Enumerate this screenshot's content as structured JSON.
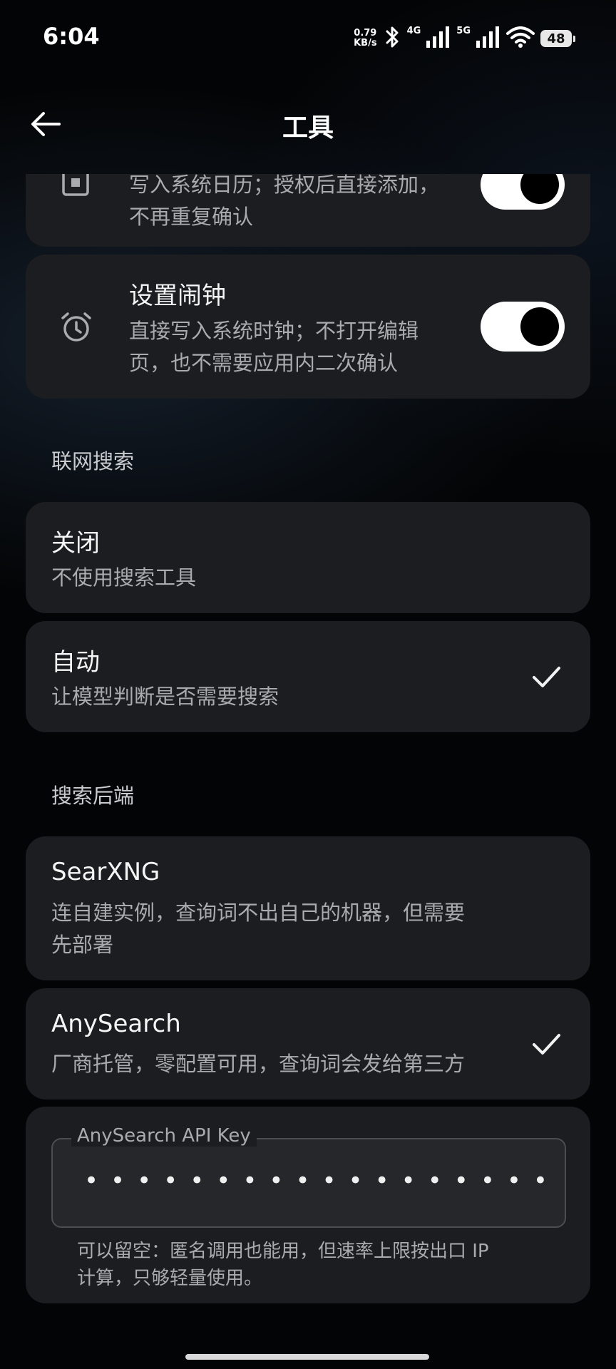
{
  "status": {
    "time": "6:04",
    "net_speed_value": "0.79",
    "net_speed_unit": "KB/s",
    "signal1_label": "4G",
    "signal2_label": "5G",
    "wifi_label": "7",
    "battery": "48"
  },
  "header": {
    "title": "工具"
  },
  "calendar_card": {
    "desc_line1": "写入系统日历；授权后直接添加，",
    "desc_line2": "不再重复确认",
    "toggle_on": true
  },
  "alarm_card": {
    "title": "设置闹钟",
    "desc_line1": "直接写入系统时钟；不打开编辑",
    "desc_line2": "页，也不需要应用内二次确认",
    "toggle_on": true
  },
  "web_search": {
    "label": "联网搜索",
    "options": [
      {
        "title": "关闭",
        "desc": "不使用搜索工具",
        "selected": false
      },
      {
        "title": "自动",
        "desc": "让模型判断是否需要搜索",
        "selected": true
      }
    ]
  },
  "search_backend": {
    "label": "搜索后端",
    "options": [
      {
        "title": "SearXNG",
        "desc_line1": "连自建实例，查询词不出自己的机器，但需要",
        "desc_line2": "先部署",
        "selected": false
      },
      {
        "title": "AnySearch",
        "desc_line1": "厂商托管，零配置可用，查询词会发给第三方",
        "selected": true
      }
    ]
  },
  "api_key": {
    "label": "AnySearch API Key",
    "value": "••••••••••••••••••••••••",
    "hint_line1": "可以留空：匿名调用也能用，但速率上限按出口 IP",
    "hint_line2": "计算，只够轻量使用。"
  },
  "colors": {
    "card_bg": "#1c1d20",
    "background": "#030405",
    "text_primary": "#f5f5f5",
    "text_secondary": "#a9abaf"
  }
}
